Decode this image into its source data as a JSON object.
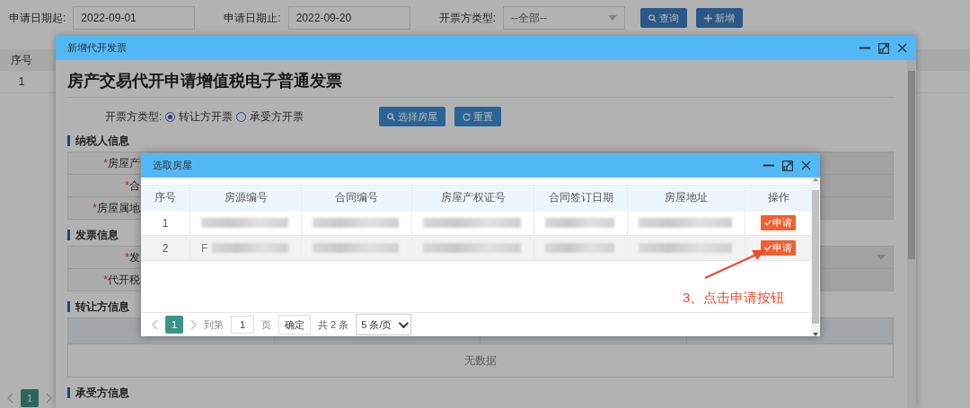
{
  "filter_bar": {
    "fields": [
      {
        "label": "申请日期起:",
        "value": "2022-09-01",
        "kind": "text"
      },
      {
        "label": "申请日期止:",
        "value": "2022-09-20",
        "kind": "text"
      },
      {
        "label": "开票方类型:",
        "value": "--全部--",
        "kind": "select"
      }
    ],
    "buttons": [
      {
        "label": "查询",
        "kind": "search"
      },
      {
        "label": "新增",
        "kind": "add"
      }
    ]
  },
  "list_table": {
    "columns": [
      "序号"
    ],
    "rows": [
      [
        "1"
      ]
    ]
  },
  "list_pagination": {
    "pages": [
      {
        "label": "1",
        "selected": true
      }
    ]
  },
  "invoice_dialog": {
    "title": "新增代开发票",
    "heading": "房产交易代开申请增值税电子普通发票",
    "issuer_type": {
      "label": "开票方类型:",
      "options": [
        {
          "label": "转让方开票",
          "selected": true
        },
        {
          "label": "承受方开票",
          "selected": false
        }
      ]
    },
    "buttons": [
      {
        "label": "选择房屋",
        "kind": "search"
      },
      {
        "label": "重置",
        "kind": "reset"
      }
    ],
    "sections": [
      {
        "title": "纳税人信息",
        "kind": "form",
        "rows": [
          {
            "mark": "*",
            "label": "房屋产",
            "kind": "text"
          },
          {
            "mark": "*",
            "label": "合",
            "kind": "text"
          },
          {
            "mark": "*",
            "label": "房屋属地",
            "kind": "text"
          }
        ]
      },
      {
        "title": "发票信息",
        "kind": "form",
        "rows": [
          {
            "mark": "*",
            "label": "发",
            "kind": "select"
          },
          {
            "mark": "*",
            "label": "代开税",
            "kind": "text"
          }
        ]
      },
      {
        "title": "转让方信息",
        "kind": "table",
        "empty_text": "无数据"
      },
      {
        "title": "承受方信息",
        "kind": "heading"
      }
    ]
  },
  "house_dialog": {
    "title": "选取房屋",
    "columns": [
      "序号",
      "房源编号",
      "合同编号",
      "房屋产权证号",
      "合同签订日期",
      "房屋地址",
      "操作"
    ],
    "rows": [
      {
        "selected": false,
        "cells": [
          {
            "text": "1",
            "redacted": false
          },
          {
            "redacted": true
          },
          {
            "redacted": true
          },
          {
            "redacted": true
          },
          {
            "redacted": true
          },
          {
            "redacted": true
          }
        ],
        "action": "申请"
      },
      {
        "selected": true,
        "cells": [
          {
            "text": "2",
            "redacted": false
          },
          {
            "text": "F",
            "redacted": true
          },
          {
            "redacted": true
          },
          {
            "redacted": true
          },
          {
            "redacted": true
          },
          {
            "redacted": true
          }
        ],
        "action": "申请"
      }
    ],
    "pagination": {
      "pages": [
        {
          "label": "1",
          "selected": true
        }
      ],
      "goto_label": "到第",
      "goto_value": "1",
      "page_unit": "页",
      "confirm": "确定",
      "total": "共 2 条",
      "page_size": "5 条/页"
    }
  },
  "annotation": {
    "text": "3、点击申请按钮"
  }
}
